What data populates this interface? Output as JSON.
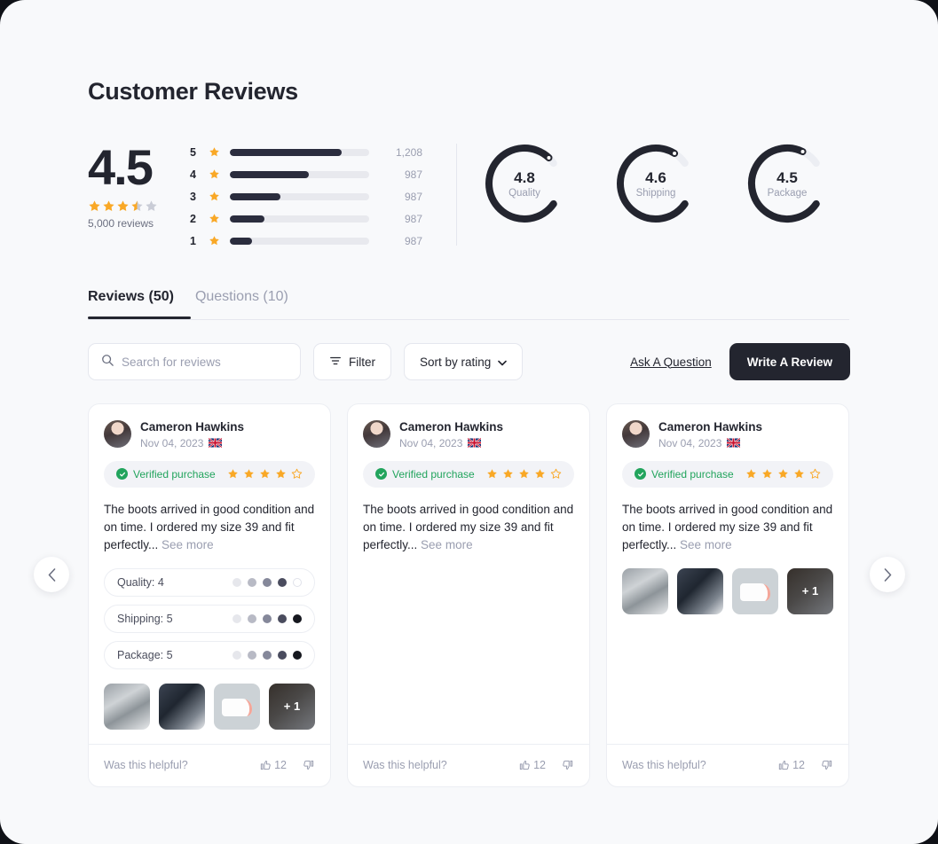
{
  "header": {
    "title": "Customer Reviews"
  },
  "summary": {
    "average": "4.5",
    "stars_filled": 3.5,
    "reviews_count": "5,000 reviews",
    "histogram": [
      {
        "stars": "5",
        "count": "1,208",
        "pct": 80
      },
      {
        "stars": "4",
        "count": "987",
        "pct": 57
      },
      {
        "stars": "3",
        "count": "987",
        "pct": 36
      },
      {
        "stars": "2",
        "count": "987",
        "pct": 25
      },
      {
        "stars": "1",
        "count": "987",
        "pct": 16
      }
    ],
    "gauges": [
      {
        "value": "4.8",
        "label": "Quality",
        "pct": 96
      },
      {
        "value": "4.6",
        "label": "Shipping",
        "pct": 92
      },
      {
        "value": "4.5",
        "label": "Package",
        "pct": 90
      }
    ]
  },
  "tabs": [
    {
      "label": "Reviews (50)",
      "active": true
    },
    {
      "label": "Questions (10)",
      "active": false
    }
  ],
  "toolbar": {
    "search_placeholder": "Search for reviews",
    "search_value": "",
    "filter_label": "Filter",
    "sort_label": "Sort by rating",
    "ask_question_label": "Ask A Question",
    "write_review_label": "Write A Review"
  },
  "reviews": [
    {
      "name": "Cameron Hawkins",
      "date": "Nov 04, 2023",
      "country": "United Kingdom",
      "verified_label": "Verified purchase",
      "rating": 4,
      "text": "The boots arrived in good condition and on time. I ordered my size 39 and fit perfectly...",
      "see_more": "See more",
      "attributes": [
        {
          "label": "Quality: 4",
          "value": 4
        },
        {
          "label": "Shipping: 5",
          "value": 5
        },
        {
          "label": "Package: 5",
          "value": 5
        }
      ],
      "photos_extra": "+ 1",
      "show_attributes": true,
      "show_photos": true,
      "helpful_label": "Was this helpful?",
      "helpful_count": "12"
    },
    {
      "name": "Cameron Hawkins",
      "date": "Nov 04, 2023",
      "country": "United Kingdom",
      "verified_label": "Verified purchase",
      "rating": 4,
      "text": "The boots arrived in good condition and on time. I ordered my size 39 and fit perfectly...",
      "see_more": "See more",
      "attributes": [],
      "photos_extra": "",
      "show_attributes": false,
      "show_photos": false,
      "helpful_label": "Was this helpful?",
      "helpful_count": "12"
    },
    {
      "name": "Cameron Hawkins",
      "date": "Nov 04, 2023",
      "country": "United Kingdom",
      "verified_label": "Verified purchase",
      "rating": 4,
      "text": "The boots arrived in good condition and on time. I ordered my size 39 and fit perfectly...",
      "see_more": "See more",
      "attributes": [],
      "photos_extra": "+ 1",
      "show_attributes": false,
      "show_photos": true,
      "helpful_label": "Was this helpful?",
      "helpful_count": "12"
    }
  ],
  "carousel": {
    "prev": "chevron-left-icon",
    "next": "chevron-right-icon"
  },
  "colors": {
    "star": "#f9a826",
    "star_empty": "#c9ccd6",
    "dark": "#23252f",
    "muted": "#9a9eb0",
    "verified_green": "#22a45d",
    "track": "#e8e9ee",
    "page_bg": "#f8f9fb"
  }
}
